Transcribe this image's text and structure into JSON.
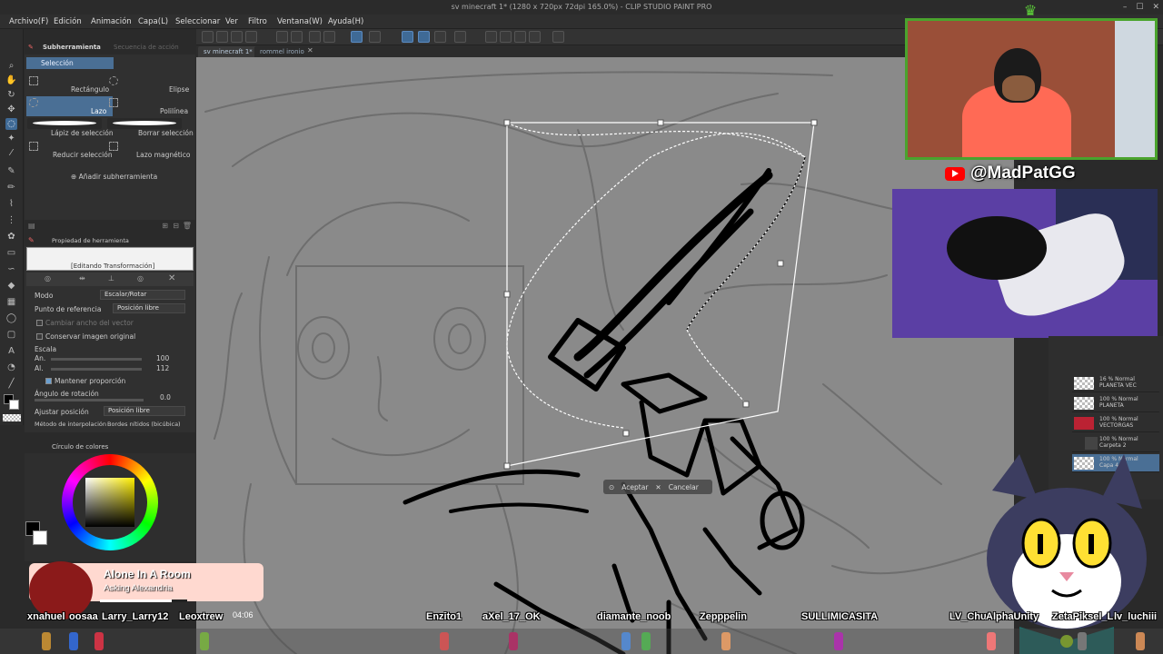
{
  "window": {
    "title": "sv minecraft 1* (1280 x 720px 72dpi 165.0%) - CLIP STUDIO PAINT PRO"
  },
  "menu": [
    "Archivo(F)",
    "Edición",
    "Animación",
    "Capa(L)",
    "Seleccionar",
    "Ver",
    "Filtro",
    "Ventana(W)",
    "Ayuda(H)"
  ],
  "tabs": [
    {
      "label": "sv minecraft 1*"
    },
    {
      "label": "rommel ironio"
    }
  ],
  "subtool_panel": {
    "tab1": "Subherramienta",
    "tab2": "Secuencia de acción",
    "group": "Selección",
    "items": {
      "rect": "Rectángulo",
      "ellipse": "Elipse",
      "lasso": "Lazo",
      "polyline": "Polilínea",
      "sel_pen": "Lápiz de selección",
      "erase_sel": "Borrar selección",
      "shrink_sel": "Reducir selección",
      "magnetic": "Lazo magnético"
    },
    "add_subtool": "Añadir subherramienta"
  },
  "tool_property": {
    "title": "Propiedad de herramienta",
    "editing": "[Editando Transformación]",
    "mode_label": "Modo",
    "mode_value": "Escalar/Rotar",
    "ref_point_label": "Punto de referencia",
    "ref_point_value": "Posición libre",
    "change_vector_width": "Cambiar ancho del vector",
    "keep_original": "Conservar imagen original",
    "scale_label": "Escala",
    "scale_w_label": "An.",
    "scale_w_value": "100",
    "scale_h_label": "Al.",
    "scale_h_value": "112",
    "keep_ratio": "Mantener proporción",
    "rotation_label": "Ángulo de rotación",
    "rotation_value": "0.0",
    "adjust_label": "Ajustar posición",
    "adjust_value": "Posición libre",
    "interp_label": "Método de interpolación",
    "interp_value": "Bordes nítidos (bicúbica)"
  },
  "color_panel": {
    "title": "Círculo de colores",
    "main_color": "#000000",
    "sub_color": "#ffffff"
  },
  "transform_confirm": {
    "accept": "Aceptar",
    "cancel": "Cancelar"
  },
  "streamer": {
    "handle": "@MadPatGG"
  },
  "layers": [
    {
      "line1": "16 % Normal",
      "line2": "PLANETA VEC"
    },
    {
      "line1": "100 % Normal",
      "line2": "PLANETA"
    },
    {
      "line1": "100 % Normal",
      "line2": "VECTORGAS"
    },
    {
      "line1": "100 % Normal",
      "line2": "Carpeta 2"
    },
    {
      "line1": "100 % Normal",
      "line2": "Capa 4"
    }
  ],
  "music": {
    "title": "Alone In A Room",
    "artist": "Asking Alexandria",
    "time": "04:06",
    "progress": 0.82
  },
  "viewers": [
    "xnahuel",
    "oosaa",
    "Larry_Larry12",
    "Leoxtrew",
    "Enzito1",
    "aXel_17_OK",
    "diamante_noob",
    "Zepppelin",
    "SULLIMICASITA",
    "LV_Chu",
    "AlphaUnity",
    "ZetaPiksel_L",
    "lv_luchiii"
  ],
  "colors": {
    "accent": "#4a6f95",
    "webcam_border": "#4aa32d",
    "youtube": "#ff0000"
  }
}
